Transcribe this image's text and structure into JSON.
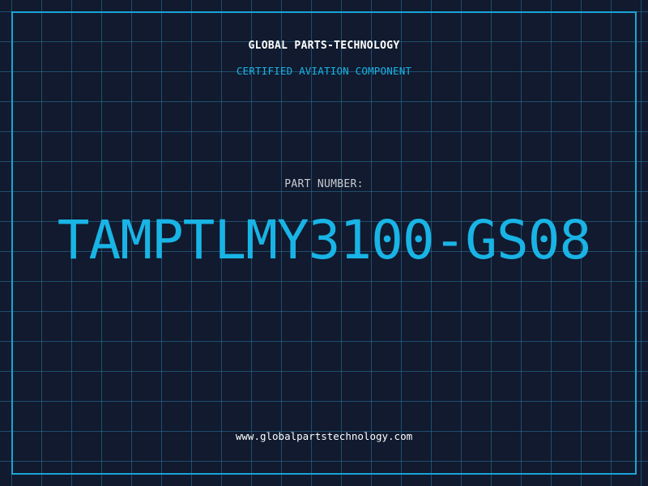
{
  "company_name": "GLOBAL PARTS-TECHNOLOGY",
  "subtitle": "CERTIFIED AVIATION COMPONENT",
  "part_number_label": "PART NUMBER:",
  "part_number": "TAMPTLMY3100-GS08",
  "website": "www.globalpartstechnology.com",
  "colors": {
    "background": "#111a2e",
    "grid": "#28789f",
    "frame": "#1aa4d6",
    "accent": "#19b4e6",
    "white_text": "#ffffff",
    "label_text": "#c9ccd4"
  }
}
